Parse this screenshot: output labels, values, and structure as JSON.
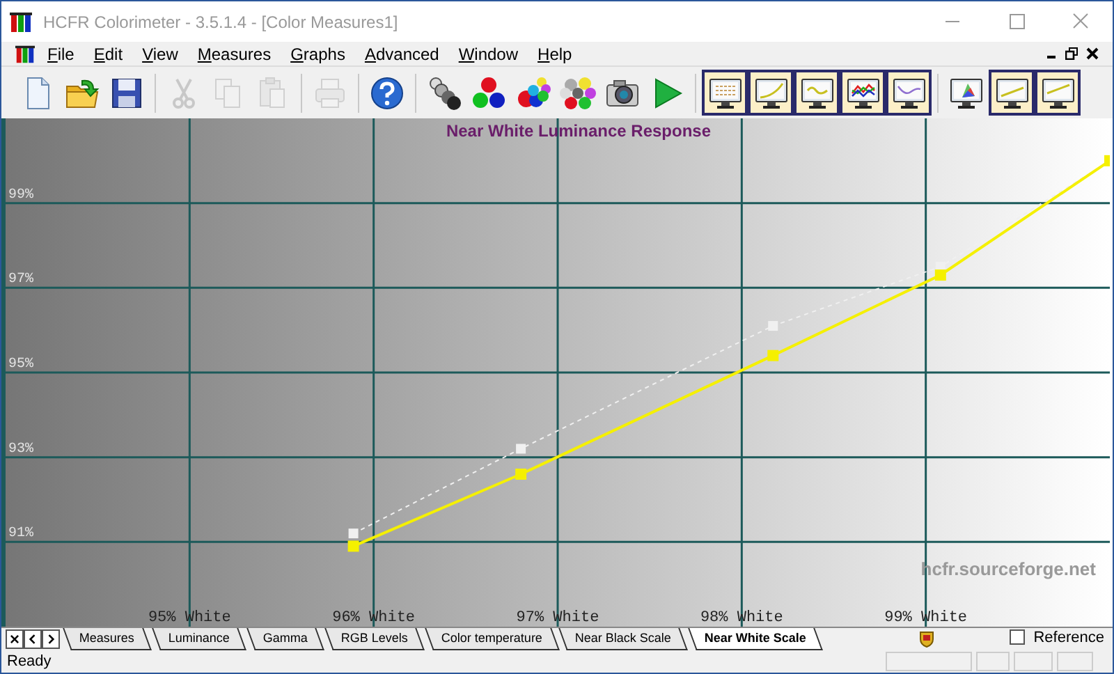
{
  "window": {
    "title": "HCFR Colorimeter - 3.5.1.4 - [Color Measures1]"
  },
  "menu": [
    {
      "label": "File"
    },
    {
      "label": "Edit"
    },
    {
      "label": "View"
    },
    {
      "label": "Measures"
    },
    {
      "label": "Graphs"
    },
    {
      "label": "Advanced"
    },
    {
      "label": "Window"
    },
    {
      "label": "Help"
    }
  ],
  "toolbar": [
    {
      "disabled": false,
      "pressed": false
    },
    {
      "disabled": false,
      "pressed": false
    },
    {
      "disabled": false,
      "pressed": false
    },
    {
      "disabled": true,
      "pressed": false
    },
    {
      "disabled": true,
      "pressed": false
    },
    {
      "disabled": true,
      "pressed": false
    },
    {
      "disabled": true,
      "pressed": false
    },
    {
      "disabled": false,
      "pressed": false
    },
    {
      "disabled": false,
      "pressed": false
    },
    {
      "disabled": false,
      "pressed": false
    },
    {
      "disabled": false,
      "pressed": false
    },
    {
      "disabled": false,
      "pressed": false
    },
    {
      "disabled": false,
      "pressed": false
    },
    {
      "disabled": false,
      "pressed": false
    },
    {
      "disabled": false,
      "pressed": true
    },
    {
      "disabled": false,
      "pressed": true
    },
    {
      "disabled": false,
      "pressed": true
    },
    {
      "disabled": false,
      "pressed": true
    },
    {
      "disabled": false,
      "pressed": true
    },
    {
      "disabled": false,
      "pressed": false
    },
    {
      "disabled": false,
      "pressed": true
    },
    {
      "disabled": false,
      "pressed": true
    }
  ],
  "chart": {
    "site_label": "hcfr.sourceforge.net",
    "chart_data": {
      "type": "line",
      "title": "Near White Luminance Response",
      "grid": true,
      "x": [
        95.89,
        96.8,
        98.17,
        99.08,
        100
      ],
      "series": [
        {
          "color": "#f0f0f0",
          "line_style": "dashed",
          "marker": "square",
          "values": [
            91.2,
            93.2,
            96.1,
            97.5,
            100
          ]
        },
        {
          "color": "#f5f000",
          "line_style": "solid",
          "marker": "square",
          "values": [
            90.9,
            92.6,
            95.4,
            97.3,
            100
          ]
        }
      ],
      "xlim": [
        94,
        100
      ],
      "ylim": [
        89,
        101
      ],
      "xticks": [
        {
          "value": 95,
          "label": "95% White"
        },
        {
          "value": 96,
          "label": "96% White"
        },
        {
          "value": 97,
          "label": "97% White"
        },
        {
          "value": 98,
          "label": "98% White"
        },
        {
          "value": 99,
          "label": "99% White"
        }
      ],
      "yticks": [
        {
          "value": 91,
          "label": "91%"
        },
        {
          "value": 93,
          "label": "93%"
        },
        {
          "value": 95,
          "label": "95%"
        },
        {
          "value": 97,
          "label": "97%"
        },
        {
          "value": 99,
          "label": "99%"
        }
      ]
    }
  },
  "tabs": [
    {
      "label": "Measures",
      "selected": false
    },
    {
      "label": "Luminance",
      "selected": false
    },
    {
      "label": "Gamma",
      "selected": false
    },
    {
      "label": "RGB Levels",
      "selected": false
    },
    {
      "label": "Color temperature",
      "selected": false
    },
    {
      "label": "Near Black Scale",
      "selected": false
    },
    {
      "label": "Near White Scale",
      "selected": true
    }
  ],
  "reference": {
    "label": "Reference",
    "checked": false
  },
  "status_bar": {
    "text": "Ready"
  }
}
